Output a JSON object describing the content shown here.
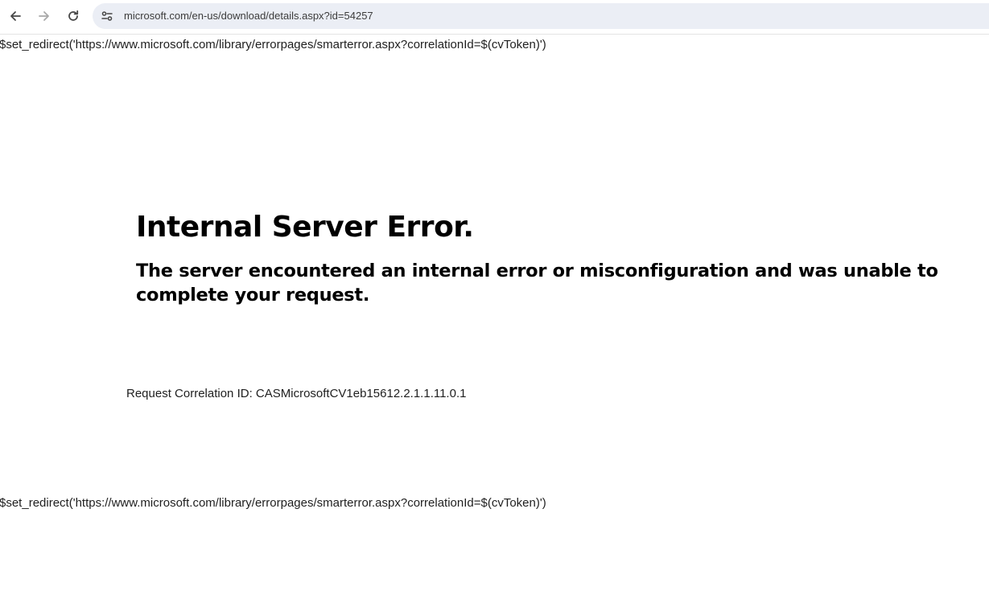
{
  "browser": {
    "url": "microsoft.com/en-us/download/details.aspx?id=54257",
    "icons": {
      "back": "arrow-left-icon",
      "forward": "arrow-right-icon",
      "reload": "reload-icon",
      "site_info": "tune-icon"
    }
  },
  "page": {
    "redirect_text": "$set_redirect('https://www.microsoft.com/library/errorpages/smarterror.aspx?correlationId=$(cvToken)')",
    "title": "Internal Server Error.",
    "message": "The server encountered an internal error or misconfiguration and was unable to complete your request.",
    "correlation": "Request Correlation ID: CASMicrosoftCV1eb15612.2.1.1.11.0.1"
  }
}
